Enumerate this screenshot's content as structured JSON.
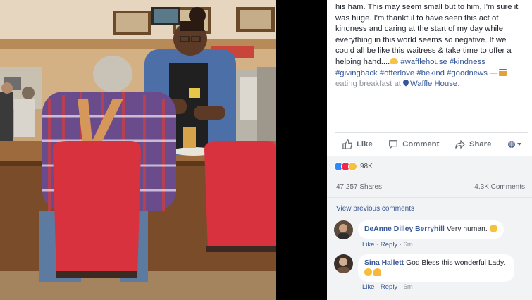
{
  "post": {
    "text_intro": "his ham. This may seem small but to him, I'm sure it was huge. I'm thankful to have seen this act of kindness and caring at the start of my day while everything in this world seems so negative. If we could all be like this waitress & take time to offer a helping hand....",
    "hashtags": [
      "#wafflehouse",
      "#kindness",
      "#givingback",
      "#offerlove",
      "#bekind",
      "#goodnews"
    ],
    "dash": "—",
    "activity": "eating breakfast at",
    "location": "Waffle House",
    "location_end": "."
  },
  "actions": {
    "like": "Like",
    "comment": "Comment",
    "share": "Share"
  },
  "reactions": {
    "count": "98K",
    "types": [
      "like",
      "love",
      "wow"
    ]
  },
  "stats": {
    "shares": "47,257 Shares",
    "comments": "4.3K Comments"
  },
  "comments_section": {
    "view_previous": "View previous comments",
    "items": [
      {
        "name": "DeAnne Dilley Berryhill",
        "text": "Very human.",
        "emoji": "smile",
        "like": "Like",
        "reply": "Reply",
        "time": "6m"
      },
      {
        "name": "Sina Hallett",
        "text": "God Bless this wonderful Lady.",
        "emoji": "kiss-pray",
        "like": "Like",
        "reply": "Reply",
        "time": "6m"
      }
    ]
  },
  "colors": {
    "link": "#365899",
    "text": "#1d2129",
    "muted": "#90949c",
    "panel_bg": "#f2f3f5",
    "like_blue": "#2d88ff",
    "love_red": "#f0284a",
    "stool_red": "#d9323f"
  },
  "photo": {
    "description_icon": "photo-image"
  }
}
